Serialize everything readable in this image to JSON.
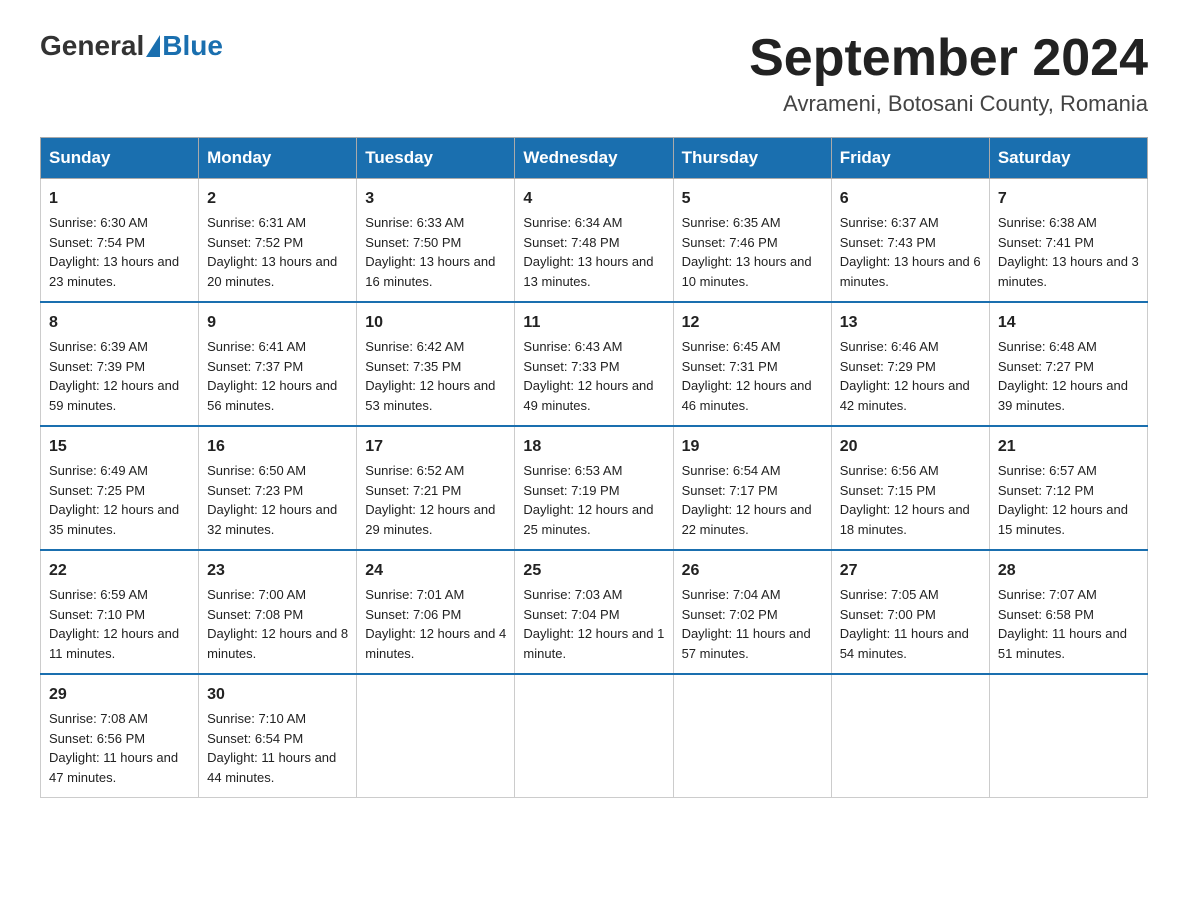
{
  "header": {
    "logo_general": "General",
    "logo_blue": "Blue",
    "month_title": "September 2024",
    "location": "Avrameni, Botosani County, Romania"
  },
  "days_of_week": [
    "Sunday",
    "Monday",
    "Tuesday",
    "Wednesday",
    "Thursday",
    "Friday",
    "Saturday"
  ],
  "weeks": [
    [
      {
        "day": "1",
        "sunrise": "6:30 AM",
        "sunset": "7:54 PM",
        "daylight": "13 hours and 23 minutes."
      },
      {
        "day": "2",
        "sunrise": "6:31 AM",
        "sunset": "7:52 PM",
        "daylight": "13 hours and 20 minutes."
      },
      {
        "day": "3",
        "sunrise": "6:33 AM",
        "sunset": "7:50 PM",
        "daylight": "13 hours and 16 minutes."
      },
      {
        "day": "4",
        "sunrise": "6:34 AM",
        "sunset": "7:48 PM",
        "daylight": "13 hours and 13 minutes."
      },
      {
        "day": "5",
        "sunrise": "6:35 AM",
        "sunset": "7:46 PM",
        "daylight": "13 hours and 10 minutes."
      },
      {
        "day": "6",
        "sunrise": "6:37 AM",
        "sunset": "7:43 PM",
        "daylight": "13 hours and 6 minutes."
      },
      {
        "day": "7",
        "sunrise": "6:38 AM",
        "sunset": "7:41 PM",
        "daylight": "13 hours and 3 minutes."
      }
    ],
    [
      {
        "day": "8",
        "sunrise": "6:39 AM",
        "sunset": "7:39 PM",
        "daylight": "12 hours and 59 minutes."
      },
      {
        "day": "9",
        "sunrise": "6:41 AM",
        "sunset": "7:37 PM",
        "daylight": "12 hours and 56 minutes."
      },
      {
        "day": "10",
        "sunrise": "6:42 AM",
        "sunset": "7:35 PM",
        "daylight": "12 hours and 53 minutes."
      },
      {
        "day": "11",
        "sunrise": "6:43 AM",
        "sunset": "7:33 PM",
        "daylight": "12 hours and 49 minutes."
      },
      {
        "day": "12",
        "sunrise": "6:45 AM",
        "sunset": "7:31 PM",
        "daylight": "12 hours and 46 minutes."
      },
      {
        "day": "13",
        "sunrise": "6:46 AM",
        "sunset": "7:29 PM",
        "daylight": "12 hours and 42 minutes."
      },
      {
        "day": "14",
        "sunrise": "6:48 AM",
        "sunset": "7:27 PM",
        "daylight": "12 hours and 39 minutes."
      }
    ],
    [
      {
        "day": "15",
        "sunrise": "6:49 AM",
        "sunset": "7:25 PM",
        "daylight": "12 hours and 35 minutes."
      },
      {
        "day": "16",
        "sunrise": "6:50 AM",
        "sunset": "7:23 PM",
        "daylight": "12 hours and 32 minutes."
      },
      {
        "day": "17",
        "sunrise": "6:52 AM",
        "sunset": "7:21 PM",
        "daylight": "12 hours and 29 minutes."
      },
      {
        "day": "18",
        "sunrise": "6:53 AM",
        "sunset": "7:19 PM",
        "daylight": "12 hours and 25 minutes."
      },
      {
        "day": "19",
        "sunrise": "6:54 AM",
        "sunset": "7:17 PM",
        "daylight": "12 hours and 22 minutes."
      },
      {
        "day": "20",
        "sunrise": "6:56 AM",
        "sunset": "7:15 PM",
        "daylight": "12 hours and 18 minutes."
      },
      {
        "day": "21",
        "sunrise": "6:57 AM",
        "sunset": "7:12 PM",
        "daylight": "12 hours and 15 minutes."
      }
    ],
    [
      {
        "day": "22",
        "sunrise": "6:59 AM",
        "sunset": "7:10 PM",
        "daylight": "12 hours and 11 minutes."
      },
      {
        "day": "23",
        "sunrise": "7:00 AM",
        "sunset": "7:08 PM",
        "daylight": "12 hours and 8 minutes."
      },
      {
        "day": "24",
        "sunrise": "7:01 AM",
        "sunset": "7:06 PM",
        "daylight": "12 hours and 4 minutes."
      },
      {
        "day": "25",
        "sunrise": "7:03 AM",
        "sunset": "7:04 PM",
        "daylight": "12 hours and 1 minute."
      },
      {
        "day": "26",
        "sunrise": "7:04 AM",
        "sunset": "7:02 PM",
        "daylight": "11 hours and 57 minutes."
      },
      {
        "day": "27",
        "sunrise": "7:05 AM",
        "sunset": "7:00 PM",
        "daylight": "11 hours and 54 minutes."
      },
      {
        "day": "28",
        "sunrise": "7:07 AM",
        "sunset": "6:58 PM",
        "daylight": "11 hours and 51 minutes."
      }
    ],
    [
      {
        "day": "29",
        "sunrise": "7:08 AM",
        "sunset": "6:56 PM",
        "daylight": "11 hours and 47 minutes."
      },
      {
        "day": "30",
        "sunrise": "7:10 AM",
        "sunset": "6:54 PM",
        "daylight": "11 hours and 44 minutes."
      },
      null,
      null,
      null,
      null,
      null
    ]
  ]
}
